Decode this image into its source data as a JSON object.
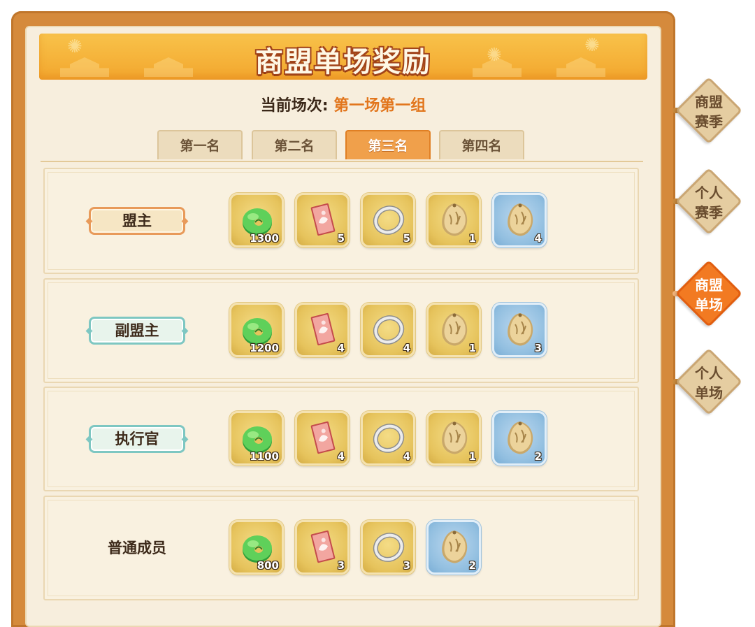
{
  "title": "商盟单场奖励",
  "round": {
    "label": "当前场次: ",
    "value": "第一场第一组"
  },
  "tabs": [
    {
      "label": "第一名",
      "active": false
    },
    {
      "label": "第二名",
      "active": false
    },
    {
      "label": "第三名",
      "active": true
    },
    {
      "label": "第四名",
      "active": false
    }
  ],
  "rewards": [
    {
      "rank": "盟主",
      "style": "gold",
      "items": [
        {
          "icon": "jade-disc-icon",
          "qty": "1300",
          "bg": "gold"
        },
        {
          "icon": "scroll-ticket-icon",
          "qty": "5",
          "bg": "gold"
        },
        {
          "icon": "silver-ring-icon",
          "qty": "5",
          "bg": "gold"
        },
        {
          "icon": "seed-pouch-icon",
          "qty": "1",
          "bg": "gold"
        },
        {
          "icon": "seed-pouch-icon",
          "qty": "4",
          "bg": "blue"
        }
      ]
    },
    {
      "rank": "副盟主",
      "style": "teal",
      "items": [
        {
          "icon": "jade-disc-icon",
          "qty": "1200",
          "bg": "gold"
        },
        {
          "icon": "scroll-ticket-icon",
          "qty": "4",
          "bg": "gold"
        },
        {
          "icon": "silver-ring-icon",
          "qty": "4",
          "bg": "gold"
        },
        {
          "icon": "seed-pouch-icon",
          "qty": "1",
          "bg": "gold"
        },
        {
          "icon": "seed-pouch-icon",
          "qty": "3",
          "bg": "blue"
        }
      ]
    },
    {
      "rank": "执行官",
      "style": "teal",
      "items": [
        {
          "icon": "jade-disc-icon",
          "qty": "1100",
          "bg": "gold"
        },
        {
          "icon": "scroll-ticket-icon",
          "qty": "4",
          "bg": "gold"
        },
        {
          "icon": "silver-ring-icon",
          "qty": "4",
          "bg": "gold"
        },
        {
          "icon": "seed-pouch-icon",
          "qty": "1",
          "bg": "gold"
        },
        {
          "icon": "seed-pouch-icon",
          "qty": "2",
          "bg": "blue"
        }
      ]
    },
    {
      "rank": "普通成员",
      "style": "plain",
      "items": [
        {
          "icon": "jade-disc-icon",
          "qty": "800",
          "bg": "gold"
        },
        {
          "icon": "scroll-ticket-icon",
          "qty": "3",
          "bg": "gold"
        },
        {
          "icon": "silver-ring-icon",
          "qty": "3",
          "bg": "gold"
        },
        {
          "icon": "seed-pouch-icon",
          "qty": "2",
          "bg": "blue"
        }
      ]
    }
  ],
  "side_tabs": [
    {
      "line1": "商盟",
      "line2": "赛季",
      "active": false
    },
    {
      "line1": "个人",
      "line2": "赛季",
      "active": false
    },
    {
      "line1": "商盟",
      "line2": "单场",
      "active": true
    },
    {
      "line1": "个人",
      "line2": "单场",
      "active": false
    }
  ]
}
